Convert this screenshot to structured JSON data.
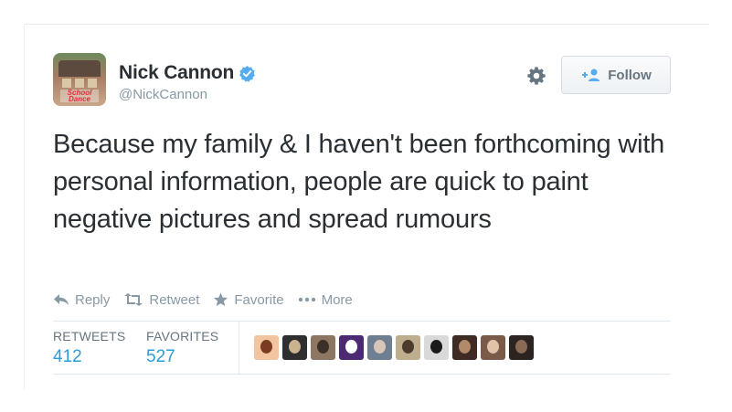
{
  "tweet": {
    "user": {
      "display_name": "Nick Cannon",
      "handle": "@NickCannon",
      "verified": true,
      "avatar_logo_text": "School Dance"
    },
    "header_actions": {
      "settings_icon": "gear-icon",
      "follow_label": "Follow",
      "follow_icon": "add-user-icon"
    },
    "text": "Because my family & I haven't been forthcoming with personal information, people are quick to paint negative pictures and spread rumours",
    "actions": [
      {
        "label": "Reply",
        "icon": "reply-icon"
      },
      {
        "label": "Retweet",
        "icon": "retweet-icon"
      },
      {
        "label": "Favorite",
        "icon": "star-icon"
      },
      {
        "label": "More",
        "icon": "ellipsis-icon"
      }
    ],
    "stats": {
      "retweets_label": "RETWEETS",
      "retweets_value": "412",
      "favorites_label": "FAVORITES",
      "favorites_value": "527"
    },
    "favoriter_avatars": [
      {
        "bg": "#f2c4a0",
        "spot": "#7a3b22"
      },
      {
        "bg": "#2f2f2f",
        "spot": "#c9b48f"
      },
      {
        "bg": "#8e7762",
        "spot": "#3c2f28"
      },
      {
        "bg": "#4b2a73",
        "spot": "#ffffff"
      },
      {
        "bg": "#6f7f92",
        "spot": "#d8c7b8"
      },
      {
        "bg": "#bfae8e",
        "spot": "#4a3b2c"
      },
      {
        "bg": "#d9d9d9",
        "spot": "#1a1a1a"
      },
      {
        "bg": "#3d2b24",
        "spot": "#b08a6a"
      },
      {
        "bg": "#7a5b4a",
        "spot": "#e0c3a8"
      },
      {
        "bg": "#2b2420",
        "spot": "#8a6a55"
      }
    ],
    "colors": {
      "link_blue": "#2a9cd8",
      "verified_blue": "#55acee",
      "meta_gray": "#8899a6"
    }
  }
}
